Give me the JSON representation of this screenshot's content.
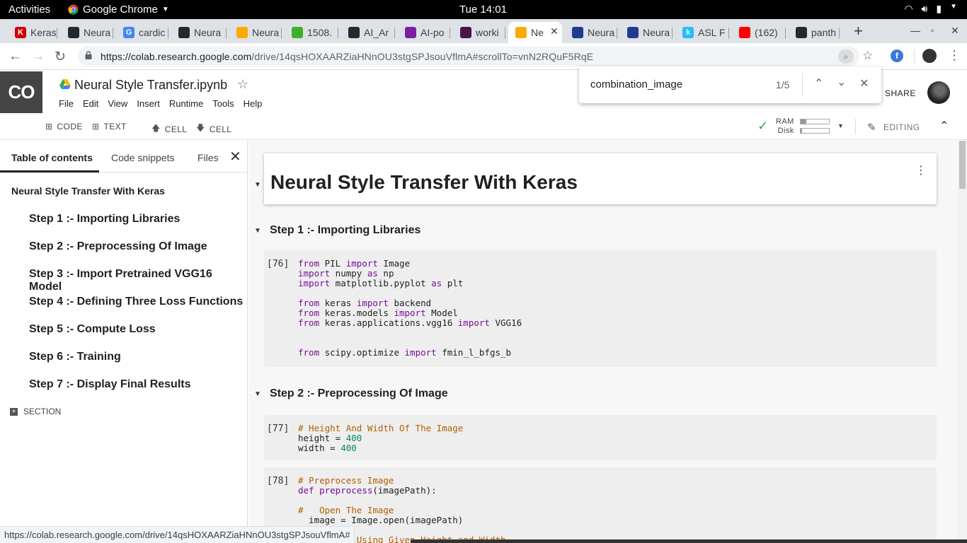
{
  "system": {
    "activities": "Activities",
    "app_name": "Google Chrome",
    "clock": "Tue 14:01"
  },
  "tabs": [
    {
      "label": "Keras",
      "favicon": "K",
      "color": "#d00000"
    },
    {
      "label": "Neura",
      "favicon": "github-icon",
      "color": "#24292e"
    },
    {
      "label": "cardic",
      "favicon": "G",
      "color": "#4285f4"
    },
    {
      "label": "Neura",
      "favicon": "github-icon",
      "color": "#24292e"
    },
    {
      "label": "Neura",
      "favicon": "colab-icon",
      "color": "#f9ab00"
    },
    {
      "label": "1508.",
      "favicon": "arxiv-icon",
      "color": "#3fae29"
    },
    {
      "label": "AI_Ar",
      "favicon": "github-icon",
      "color": "#24292e"
    },
    {
      "label": "AI-po",
      "favicon": "v-icon",
      "color": "#7b1fa2"
    },
    {
      "label": "worki",
      "favicon": "slack-icon",
      "color": "#4a154b"
    },
    {
      "label": "Ne",
      "favicon": "colab-icon",
      "color": "#f9ab00",
      "active": true
    },
    {
      "label": "Neura",
      "favicon": "doc-icon",
      "color": "#1f3a93"
    },
    {
      "label": "Neura",
      "favicon": "doc-icon",
      "color": "#1f3a93"
    },
    {
      "label": "ASL F",
      "favicon": "k",
      "color": "#20beff"
    },
    {
      "label": "(162)",
      "favicon": "youtube-icon",
      "color": "#ff0000"
    },
    {
      "label": "panth",
      "favicon": "github-icon",
      "color": "#24292e"
    }
  ],
  "omnibox": {
    "url_host": "https://colab.research.google.com",
    "url_path": "/drive/14qsHOXAARZiaHNnOU3stgSPJsouVflmA#scrollTo=vnN2RQuF5RqE"
  },
  "colab": {
    "logo": "CO",
    "notebook_title": "Neural Style Transfer.ipynb",
    "menu": [
      "File",
      "Edit",
      "View",
      "Insert",
      "Runtime",
      "Tools",
      "Help"
    ],
    "share": "SHARE",
    "toolbar": {
      "code": "CODE",
      "text": "TEXT",
      "cell_up": "CELL",
      "cell_down": "CELL",
      "ram": "RAM",
      "disk": "Disk",
      "ram_fraction": 0.2,
      "disk_fraction": 0.05,
      "editing": "EDITING"
    }
  },
  "find": {
    "query": "combination_image",
    "count": "1/5"
  },
  "sidebar": {
    "tabs": [
      "Table of contents",
      "Code snippets",
      "Files"
    ],
    "toc": [
      {
        "label": "Neural Style Transfer With Keras",
        "level": 1
      },
      {
        "label": "Step 1 :- Importing Libraries",
        "level": 2
      },
      {
        "label": "Step 2 :- Preprocessing Of Image",
        "level": 2
      },
      {
        "label": "Step 3 :- Import Pretrained VGG16 Model",
        "level": 2
      },
      {
        "label": "Step 4 :- Defining Three Loss Functions",
        "level": 2
      },
      {
        "label": "Step 5 :- Compute Loss",
        "level": 2
      },
      {
        "label": "Step 6 :- Training",
        "level": 2
      },
      {
        "label": "Step 7 :- Display Final Results",
        "level": 2
      }
    ],
    "section": "SECTION"
  },
  "notebook": {
    "title": "Neural Style Transfer With Keras",
    "step1": "Step 1 :- Importing Libraries",
    "step2": "Step 2 :- Preprocessing Of Image",
    "cell76_exec": "[76]",
    "cell77_exec": "[77]",
    "cell78_exec": "[78]"
  },
  "status_url": "https://colab.research.google.com/drive/14qsHOXAARZiaHNnOU3stgSPJsouVflmA#"
}
